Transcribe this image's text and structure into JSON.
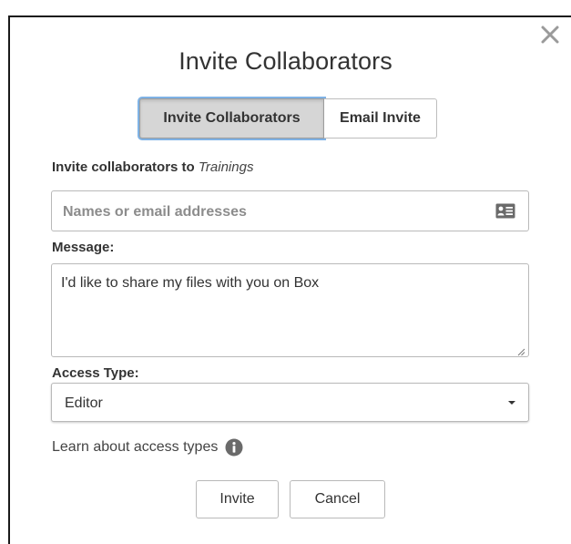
{
  "dialog": {
    "title": "Invite Collaborators",
    "close_icon": "close-icon"
  },
  "tabs": [
    {
      "label": "Invite Collaborators",
      "active": true
    },
    {
      "label": "Email Invite",
      "active": false
    }
  ],
  "invite_to": {
    "prefix": "Invite collaborators to",
    "folder": "Trainings"
  },
  "names_input": {
    "placeholder": "Names or email addresses",
    "value": "",
    "icon": "contact-card-icon"
  },
  "message": {
    "label": "Message:",
    "value": "I'd like to share my files with you on Box"
  },
  "access_type": {
    "label": "Access Type:",
    "selected": "Editor"
  },
  "learn_link": {
    "text": "Learn about access types",
    "icon": "info-icon"
  },
  "buttons": {
    "invite": "Invite",
    "cancel": "Cancel"
  },
  "colors": {
    "active_tab_bg": "#d6d6d6",
    "focus_ring": "#7fb2e5",
    "border": "#b9b9b9",
    "placeholder": "#8c8c8c"
  }
}
